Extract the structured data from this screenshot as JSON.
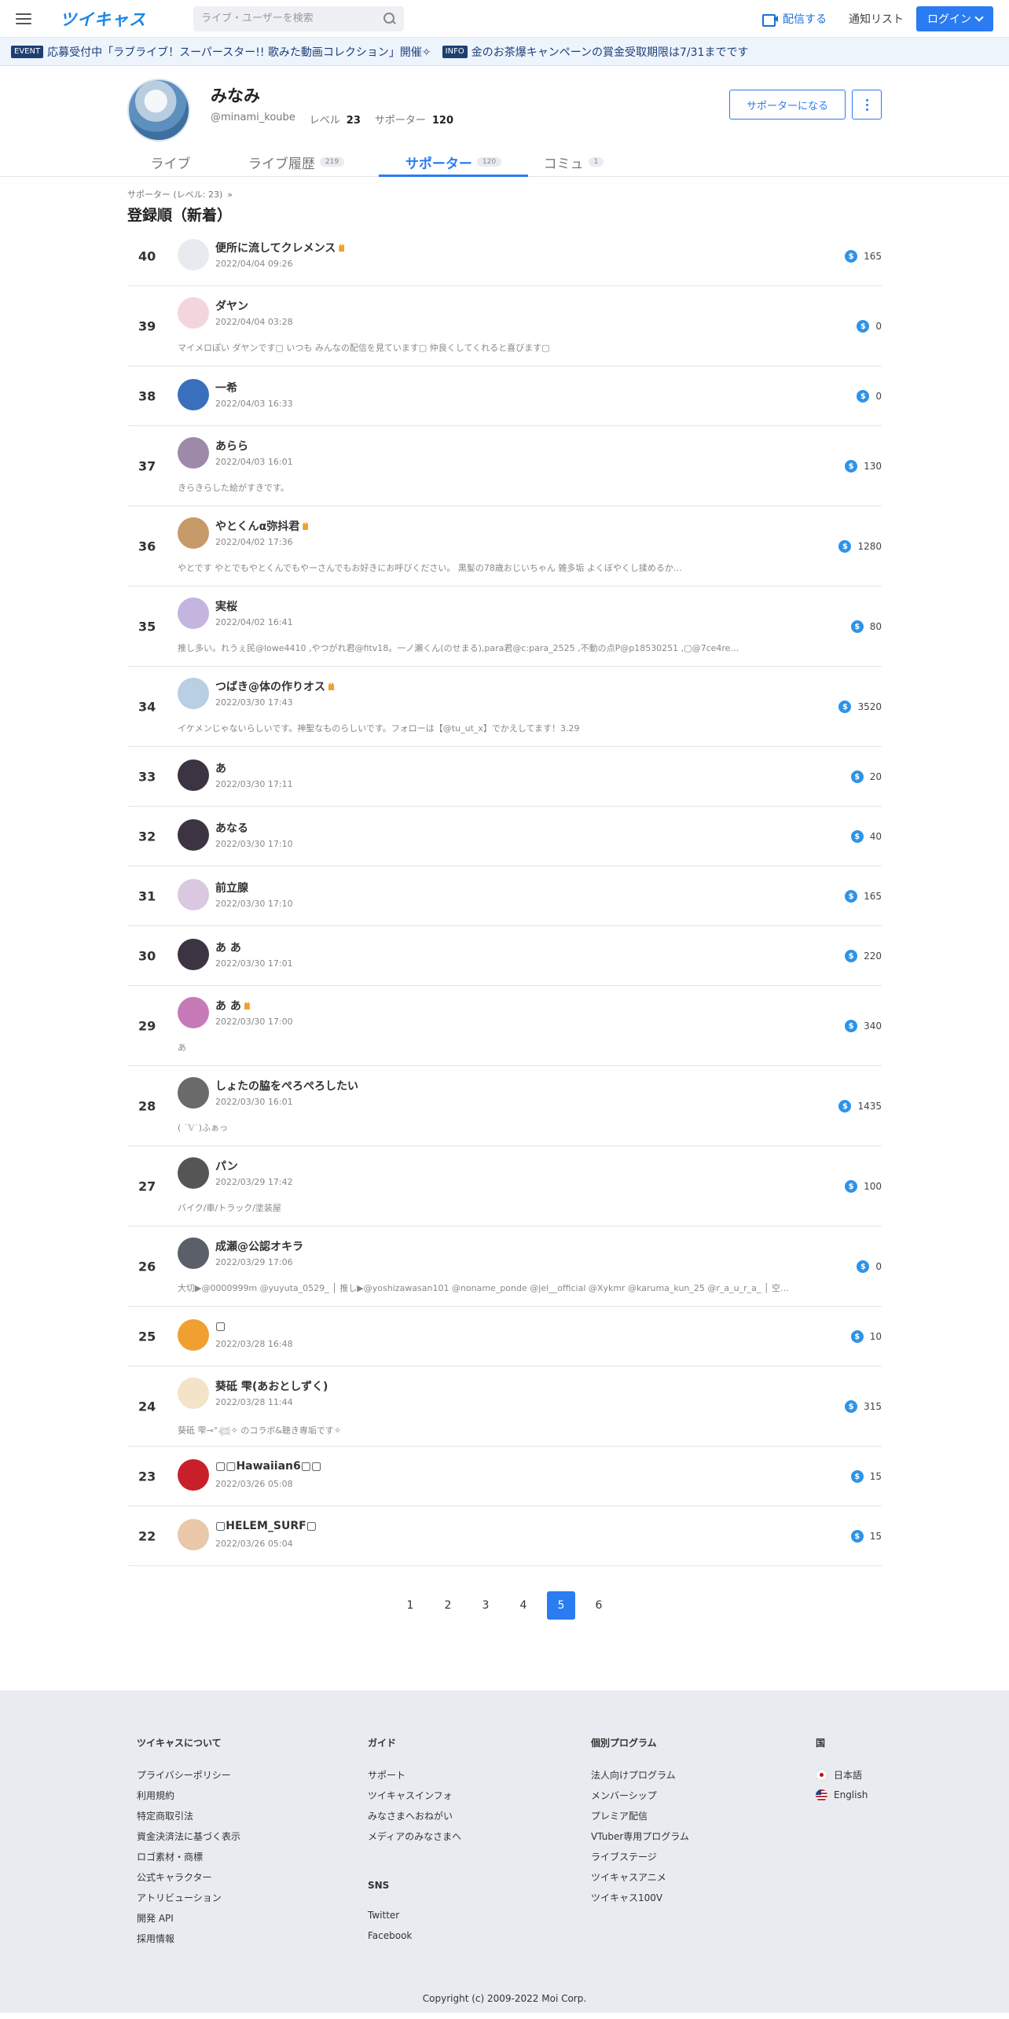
{
  "header": {
    "logo": "ツイキャス",
    "search_placeholder": "ライブ・ユーザーを検索",
    "broadcast_label": "配信する",
    "notify_label": "通知リスト",
    "login_label": "ログイン"
  },
  "banner": {
    "event_tag": "EVENT",
    "event_text": "応募受付中「ラブライブ！スーパースター!! 歌みた動画コレクション」開催✧",
    "info_tag": "INFO",
    "info_text": "金のお茶爆キャンペーンの賞金受取期限は7/31までです"
  },
  "profile": {
    "name": "みなみ",
    "handle": "@minami_koube",
    "level_label": "レベル",
    "level": "23",
    "supporter_label": "サポーター",
    "supporters": "120",
    "support_button": "サポーターになる"
  },
  "tabs": [
    {
      "label": "ライブ",
      "count": ""
    },
    {
      "label": "ライブ履歴",
      "count": "219"
    },
    {
      "label": "サポーター",
      "count": "120"
    },
    {
      "label": "コミュ",
      "count": "1"
    }
  ],
  "subhead": "サポーター (レベル: 23)",
  "subhead_arrow": "»",
  "section_title": "登録順（新着）",
  "supporters": [
    {
      "rank": "40",
      "name": "便所に流してクレメンス",
      "crown": true,
      "date": "2022/04/04 09:26",
      "comment": "",
      "points": "165",
      "avatar": "#e7ebf0"
    },
    {
      "rank": "39",
      "name": "ダヤン",
      "crown": false,
      "date": "2022/04/04 03:28",
      "comment": "マイメロぽい ダヤンです▢ いつも みんなの配信を見ています▢ 仲良くしてくれると喜びます▢",
      "points": "0",
      "avatar": "#f3d6dc"
    },
    {
      "rank": "38",
      "name": "一希",
      "crown": false,
      "date": "2022/04/03 16:33",
      "comment": "",
      "points": "0",
      "avatar": "#3a6fbe"
    },
    {
      "rank": "37",
      "name": "あらら",
      "crown": false,
      "date": "2022/04/03 16:01",
      "comment": "きらきらした絵がすきです。",
      "points": "130",
      "avatar": "#9c8aa8"
    },
    {
      "rank": "36",
      "name": "やとくんα弥抖君",
      "crown": true,
      "date": "2022/04/02 17:36",
      "comment": "やとです やとでもやとくんでもやーさんでもお好きにお呼びください。 黒髪の78歳おじいちゃん 雑多垢 よくぼやくし揉めるか…",
      "points": "1280",
      "avatar": "#c79a6a"
    },
    {
      "rank": "35",
      "name": "実桜",
      "crown": false,
      "date": "2022/04/02 16:41",
      "comment": "推し多い。れうぇ民@lowe4410 ,やつがれ君@fitv18。一ノ瀬くん(のせまる),para君@c:para_2525 ,不動の点P@p18530251 ,▢@7ce4re…",
      "points": "80",
      "avatar": "#c4b5e0"
    },
    {
      "rank": "34",
      "name": "つばき@体の作りオス",
      "crown": true,
      "date": "2022/03/30 17:43",
      "comment": "イケメンじゃないらしいです。神聖なものらしいです。フォローは【@tu_ut_x】でかえしてます！3.29",
      "points": "3520",
      "avatar": "#b9cfe3"
    },
    {
      "rank": "33",
      "name": "あ",
      "crown": false,
      "date": "2022/03/30 17:11",
      "comment": "",
      "points": "20",
      "avatar": "#3c3442"
    },
    {
      "rank": "32",
      "name": "あなる",
      "crown": false,
      "date": "2022/03/30 17:10",
      "comment": "",
      "points": "40",
      "avatar": "#3c3442"
    },
    {
      "rank": "31",
      "name": "前立腺",
      "crown": false,
      "date": "2022/03/30 17:10",
      "comment": "",
      "points": "165",
      "avatar": "#d9c8e0"
    },
    {
      "rank": "30",
      "name": "あ あ",
      "crown": false,
      "date": "2022/03/30 17:01",
      "comment": "",
      "points": "220",
      "avatar": "#3c3442"
    },
    {
      "rank": "29",
      "name": "あ あ",
      "crown": true,
      "date": "2022/03/30 17:00",
      "comment": "あ",
      "points": "340",
      "avatar": "#c67bb8"
    },
    {
      "rank": "28",
      "name": "しょたの脇をぺろぺろしたい",
      "crown": false,
      "date": "2022/03/30 16:01",
      "comment": "( ˙𝕍˙)ふぁっ",
      "points": "1435",
      "avatar": "#6a6a6a"
    },
    {
      "rank": "27",
      "name": "パン",
      "crown": false,
      "date": "2022/03/29 17:42",
      "comment": "バイク/車/トラック/塗装屋",
      "points": "100",
      "avatar": "#555555"
    },
    {
      "rank": "26",
      "name": "成瀬@公認オキラ",
      "crown": false,
      "date": "2022/03/29 17:06",
      "comment": "大切▶@0000999m @yuyuta_0529_ │ 推し▶@yoshizawasan101 @noname_ponde @jel__official @Xykmr @karuma_kun_25 @r_a_u_r_a_ │ 空…",
      "points": "0",
      "avatar": "#5a5f6a"
    },
    {
      "rank": "25",
      "name": "▢",
      "crown": false,
      "date": "2022/03/28 16:48",
      "comment": "",
      "points": "10",
      "avatar": "#f0a030"
    },
    {
      "rank": "24",
      "name": "葵砥 雫(あおとしずく)",
      "crown": false,
      "date": "2022/03/28 11:44",
      "comment": "葵砥 雫⊸°𓆉✧ のコラボ&聴き専垢です✧",
      "points": "315",
      "avatar": "#f3e4c8"
    },
    {
      "rank": "23",
      "name": "▢▢Hawaiian6▢▢",
      "crown": false,
      "date": "2022/03/26 05:08",
      "comment": "",
      "points": "15",
      "avatar": "#c8202a"
    },
    {
      "rank": "22",
      "name": "▢HELEM_SURF▢",
      "crown": false,
      "date": "2022/03/26 05:04",
      "comment": "",
      "points": "15",
      "avatar": "#e8c8a8"
    }
  ],
  "pager": [
    "1",
    "2",
    "3",
    "4",
    "5",
    "6"
  ],
  "pager_active": "5",
  "footer": {
    "col1": {
      "title": "ツイキャスについて",
      "items": [
        "プライバシーポリシー",
        "利用規約",
        "特定商取引法",
        "資金決済法に基づく表示",
        "ロゴ素材・商標",
        "公式キャラクター",
        "アトリビューション",
        "開発 API",
        "採用情報"
      ]
    },
    "col2": {
      "title": "ガイド",
      "items": [
        "サポート",
        "ツイキャスインフォ",
        "みなさまへおねがい",
        "メディアのみなさまへ"
      ]
    },
    "col2b": {
      "title": "SNS",
      "items": [
        "Twitter",
        "Facebook"
      ]
    },
    "col3": {
      "title": "個別プログラム",
      "items": [
        "法人向けプログラム",
        "メンバーシップ",
        "プレミア配信",
        "VTuber専用プログラム",
        "ライブステージ",
        "ツイキャスアニメ",
        "ツイキャス100V"
      ]
    },
    "col4": {
      "title": "国",
      "items": [
        "日本語",
        "English"
      ]
    },
    "copyright": "Copyright (c) 2009-2022 Moi Corp."
  },
  "colors": {
    "accent": "#2b7bf2",
    "coin": "#2e93e8",
    "crown": "#f0a030"
  }
}
